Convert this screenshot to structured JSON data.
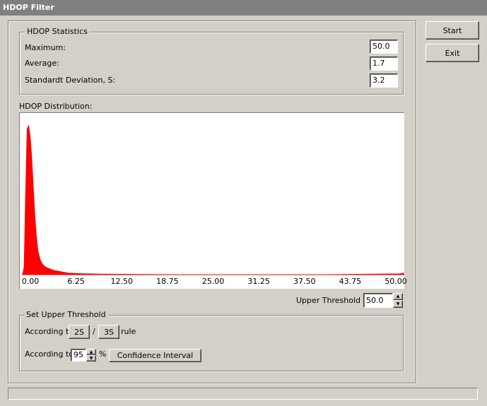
{
  "window": {
    "title": "HDOP Filter"
  },
  "buttons": {
    "start": "Start",
    "exit": "Exit"
  },
  "stats": {
    "group_title": "HDOP Statistics",
    "maximum_label": "Maximum:",
    "maximum_value": "50.0",
    "average_label": "Average:",
    "average_value": "1.7",
    "stddev_label": "Standardt Deviation, S:",
    "stddev_value": "3.2"
  },
  "distribution": {
    "label": "HDOP Distribution:"
  },
  "chart_data": {
    "type": "area",
    "x": [
      0.0,
      0.2,
      0.4,
      0.6,
      0.8,
      1.0,
      1.2,
      1.4,
      1.6,
      1.8,
      2.0,
      2.3,
      2.6,
      3.0,
      3.5,
      4.0,
      5.0,
      6.0,
      8.0,
      10.0,
      15.0,
      20.0,
      30.0,
      40.0,
      49.5,
      50.0
    ],
    "values": [
      0,
      5,
      55,
      98,
      100,
      92,
      78,
      58,
      40,
      26,
      16,
      10,
      7,
      5,
      4,
      3,
      2,
      1,
      0.6,
      0.4,
      0.2,
      0,
      0,
      0,
      0.5,
      1
    ],
    "xlim": [
      0,
      50
    ],
    "x_ticks": [
      "0.00",
      "6.25",
      "12.50",
      "18.75",
      "25.00",
      "31.25",
      "37.50",
      "43.75",
      "50.00"
    ],
    "color": "#ff0000",
    "grid": false
  },
  "threshold": {
    "label": "Upper Threshold",
    "value": "50.0"
  },
  "set_threshold": {
    "group_title": "Set Upper Threshold",
    "according_to_1": "According to",
    "btn_2s": "2S",
    "slash": "/",
    "btn_3s": "3S",
    "rule": "rule",
    "according_to_2": "According to",
    "percent_value": "95",
    "percent_sign": "%",
    "confidence_button": "Confidence Interval"
  }
}
